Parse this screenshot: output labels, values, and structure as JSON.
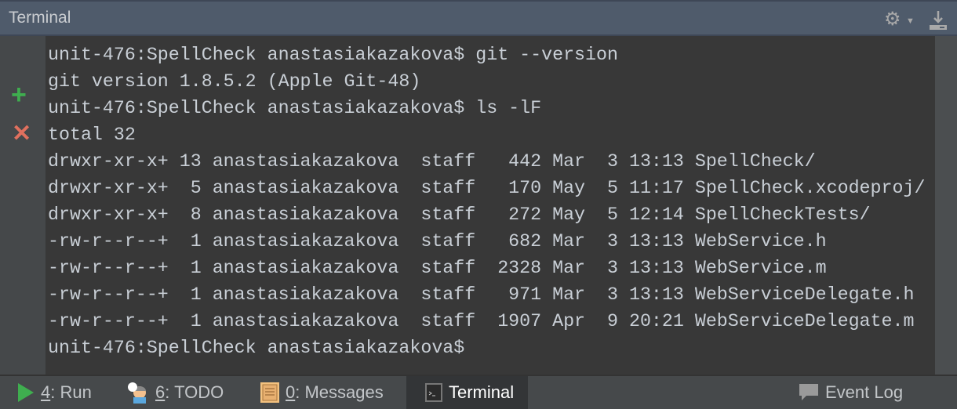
{
  "header": {
    "title": "Terminal"
  },
  "terminal": {
    "lines": [
      "unit-476:SpellCheck anastasiakazakova$ git --version",
      "git version 1.8.5.2 (Apple Git-48)",
      "unit-476:SpellCheck anastasiakazakova$ ls -lF",
      "total 32",
      "drwxr-xr-x+ 13 anastasiakazakova  staff   442 Mar  3 13:13 SpellCheck/",
      "drwxr-xr-x+  5 anastasiakazakova  staff   170 May  5 11:17 SpellCheck.xcodeproj/",
      "drwxr-xr-x+  8 anastasiakazakova  staff   272 May  5 12:14 SpellCheckTests/",
      "-rw-r--r--+  1 anastasiakazakova  staff   682 Mar  3 13:13 WebService.h",
      "-rw-r--r--+  1 anastasiakazakova  staff  2328 Mar  3 13:13 WebService.m",
      "-rw-r--r--+  1 anastasiakazakova  staff   971 Mar  3 13:13 WebServiceDelegate.h",
      "-rw-r--r--+  1 anastasiakazakova  staff  1907 Apr  9 20:21 WebServiceDelegate.m",
      "unit-476:SpellCheck anastasiakazakova$"
    ]
  },
  "bottom": {
    "tabs": [
      {
        "key": "4",
        "label": ": Run"
      },
      {
        "key": "6",
        "label": ": TODO"
      },
      {
        "key": "0",
        "label": ": Messages"
      },
      {
        "label": "Terminal"
      },
      {
        "label": "Event Log"
      }
    ]
  }
}
